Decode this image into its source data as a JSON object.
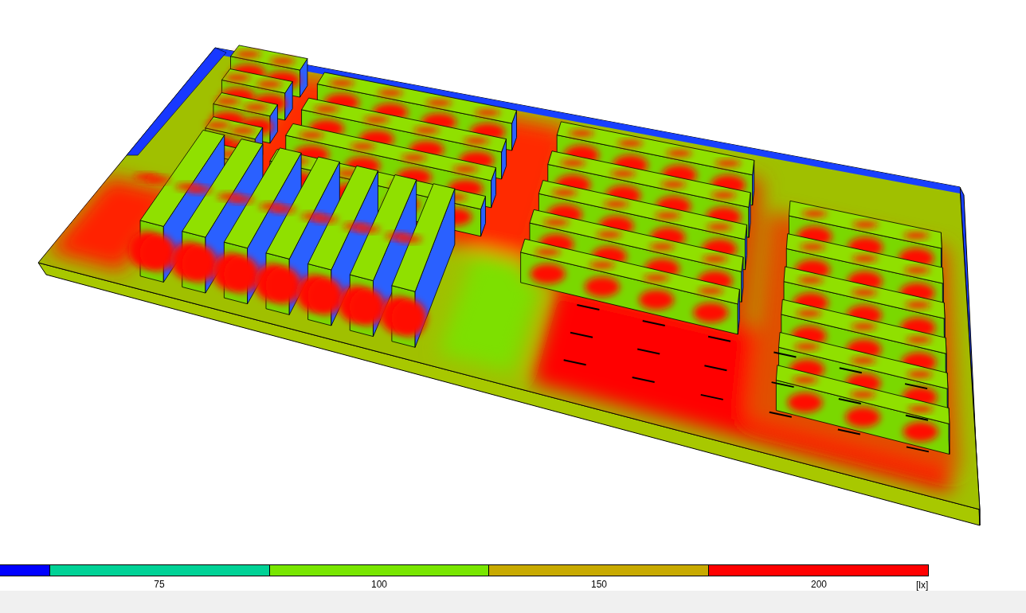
{
  "legend": {
    "segments": [
      {
        "color": "#0000ff"
      },
      {
        "color": "#00d296",
        "label": "75"
      },
      {
        "color": "#78e600",
        "label": "100"
      },
      {
        "color": "#c8aa00",
        "label": "150"
      },
      {
        "color": "#ff0000",
        "label": "200"
      }
    ],
    "unit": "[lx]"
  }
}
